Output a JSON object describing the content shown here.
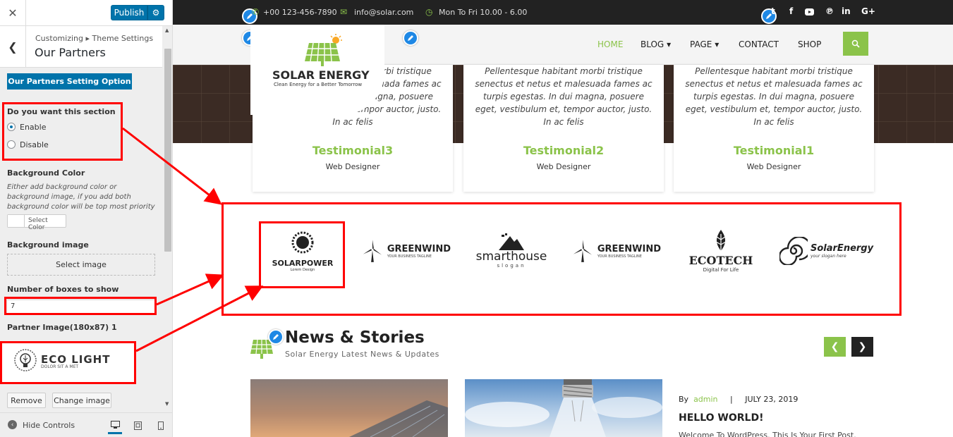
{
  "customizer": {
    "publish_label": "Publish",
    "breadcrumb": "Customizing ▸ Theme Settings",
    "section_title": "Our Partners",
    "option_button": "Our Partners Setting Option",
    "section_question": "Do you want this section",
    "radio_options": [
      "Enable",
      "Disable"
    ],
    "radio_selected": "Enable",
    "bg_color_label": "Background Color",
    "bg_color_desc": "Either add background color or background image, if you add both background color will be top most priority",
    "select_color_label": "Select Color",
    "bg_image_label": "Background image",
    "select_image_label": "Select image",
    "boxes_label": "Number of boxes to show",
    "boxes_value": "7",
    "partner_image_label": "Partner Image(180x87) 1",
    "partner_image_title": "ECO LIGHT",
    "partner_image_sub": "DOLOR SIT A MET",
    "remove_label": "Remove",
    "change_image_label": "Change image",
    "hide_controls_label": "Hide Controls"
  },
  "site": {
    "topbar": {
      "phone": "+00 123-456-7890",
      "email": "info@solar.com",
      "hours": "Mon To Fri 10.00 - 6.00"
    },
    "logo": {
      "title": "SOLAR ENERGY",
      "tagline": "Clean Energy for a Better Tomorrow"
    },
    "nav": [
      "HOME",
      "BLOG",
      "PAGE",
      "CONTACT",
      "SHOP"
    ],
    "testimonials": [
      {
        "quote": "Pellentesque habitant morbi tristique senectus et netus et malesuada fames ac turpis egestas. In dui magna, posuere eget, vestibulum et, tempor auctor, justo. In ac felis",
        "name": "Testimonial3",
        "role": "Web Designer"
      },
      {
        "quote": "Pellentesque habitant morbi tristique senectus et netus et malesuada fames ac turpis egestas. In dui magna, posuere eget, vestibulum et, tempor auctor, justo. In ac felis",
        "name": "Testimonial2",
        "role": "Web Designer"
      },
      {
        "quote": "Pellentesque habitant morbi tristique senectus et netus et malesuada fames ac turpis egestas. In dui magna, posuere eget, vestibulum et, tempor auctor, justo. In ac felis",
        "name": "Testimonial1",
        "role": "Web Designer"
      }
    ],
    "partners": {
      "solarpower": {
        "name": "SOLARPOWER",
        "sub": "Lorem Design"
      },
      "greenwind1": {
        "name": "GREENWIND",
        "sub": "YOUR BUSINESS TAGLINE"
      },
      "smarthouse": {
        "name": "smarthouse",
        "sub": "slogan"
      },
      "greenwind2": {
        "name": "GREENWIND",
        "sub": "YOUR BUSINESS TAGLINE"
      },
      "ecotech": {
        "name": "ECOTECH",
        "sub": "Digital For Life"
      },
      "solarenergy": {
        "name": "SolarEnergy",
        "sub": "your slogan here"
      }
    },
    "news": {
      "title": "News & Stories",
      "subtitle": "Solar Energy Latest News & Updates",
      "by": "By",
      "author": "admin",
      "separator": "|",
      "date": "JULY 23, 2019",
      "post_title": "HELLO WORLD!",
      "excerpt": "Welcome To WordPress. This Is Your First Post."
    }
  },
  "colors": {
    "accent_green": "#8bc34a",
    "wp_blue": "#0073aa",
    "highlight_red": "#ff0000",
    "topbar": "#222222"
  }
}
